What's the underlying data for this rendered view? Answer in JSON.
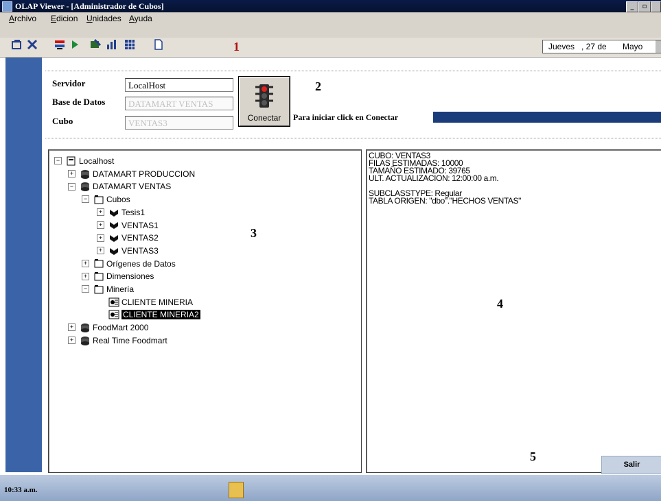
{
  "window": {
    "title": "OLAP Viewer - [Administrador de Cubos]",
    "minimize": "_",
    "restore": "▫"
  },
  "menu": [
    "Archivo",
    "Edicion",
    "Unidades",
    "Ayuda"
  ],
  "toolbar": {
    "date_day": "Jueves",
    "date_num": ", 27 de",
    "date_month": "Mayo"
  },
  "annotations": [
    "1",
    "2",
    "3",
    "4",
    "5"
  ],
  "connection": {
    "server_label": "Servidor",
    "server_value": "LocalHost",
    "db_label": "Base de Datos",
    "db_value": "DATAMART VENTAS",
    "cube_label": "Cubo",
    "cube_value": "VENTAS3",
    "connect_button": "Conectar",
    "hint": "Para iniciar click en Conectar"
  },
  "tree": [
    {
      "text": "Localhost",
      "level": 0,
      "expander": "−",
      "icon": "server-icon"
    },
    {
      "text": "DATAMART PRODUCCION",
      "level": 1,
      "expander": "+",
      "icon": "database-icon"
    },
    {
      "text": "DATAMART VENTAS",
      "level": 1,
      "expander": "−",
      "icon": "database-icon"
    },
    {
      "text": "Cubos",
      "level": 2,
      "expander": "−",
      "icon": "folder-icon"
    },
    {
      "text": "Tesis1",
      "level": 3,
      "expander": "+",
      "icon": "cube-icon"
    },
    {
      "text": "VENTAS1",
      "level": 3,
      "expander": "+",
      "icon": "cube-icon"
    },
    {
      "text": "VENTAS2",
      "level": 3,
      "expander": "+",
      "icon": "cube-icon"
    },
    {
      "text": "VENTAS3",
      "level": 3,
      "expander": "+",
      "icon": "cube-icon"
    },
    {
      "text": "Orígenes de Datos",
      "level": 2,
      "expander": "+",
      "icon": "folder-icon"
    },
    {
      "text": "Dimensiones",
      "level": 2,
      "expander": "+",
      "icon": "folder-icon"
    },
    {
      "text": "Minería",
      "level": 2,
      "expander": "−",
      "icon": "folder-icon"
    },
    {
      "text": "CLIENTE MINERIA",
      "level": 3,
      "expander": "",
      "icon": "mining-model-icon"
    },
    {
      "text": "CLIENTE MINERIA2",
      "level": 3,
      "expander": "",
      "icon": "mining-model-icon",
      "selected": true
    },
    {
      "text": "FoodMart 2000",
      "level": 1,
      "expander": "+",
      "icon": "database-icon"
    },
    {
      "text": "Real Time Foodmart",
      "level": 1,
      "expander": "+",
      "icon": "database-icon"
    }
  ],
  "details": [
    "CUBO: VENTAS3",
    "FILAS ESTIMADAS: 10000",
    "TAMAÑO ESTIMADO: 39765",
    "ULT. ACTUALIZACION: 12:00:00 a.m.",
    "",
    "SUBCLASSTYPE: Regular",
    "TABLA ORIGEN: \"dbo\".\"HECHOS VENTAS\""
  ],
  "exit_button": "Salir",
  "status": {
    "time": "10:33 a.m."
  },
  "colors": {
    "title_bar": "#06122e",
    "left_strip": "#3b63a8",
    "progress": "#1a3c7a",
    "annotation_1": "#b01010"
  }
}
